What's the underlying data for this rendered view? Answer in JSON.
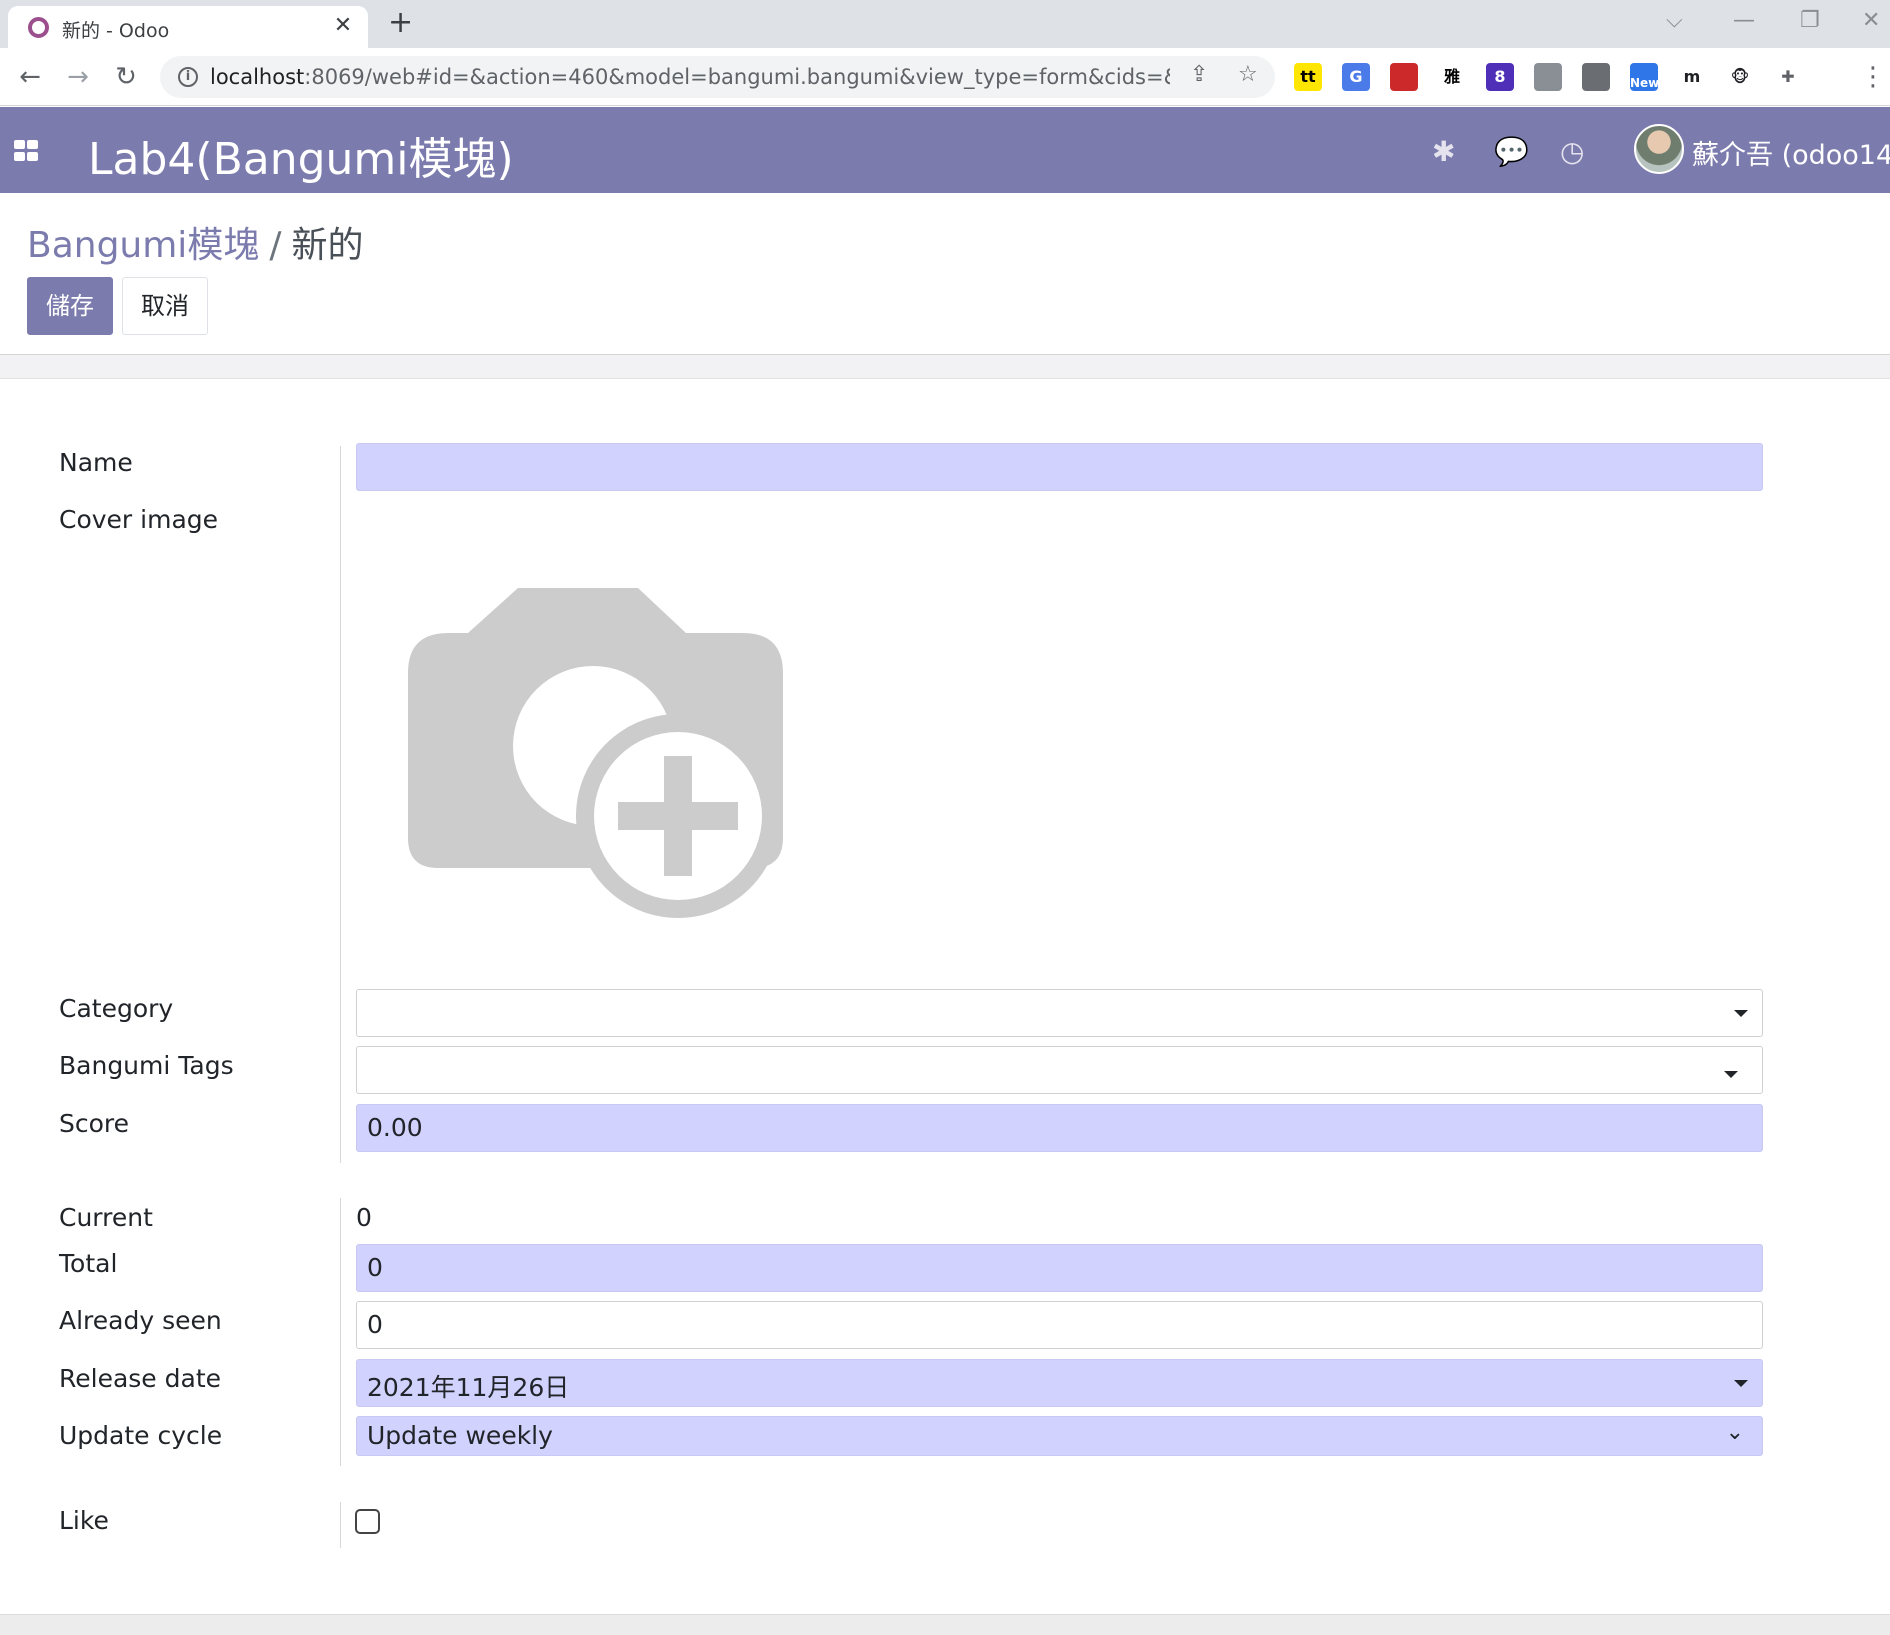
{
  "browser": {
    "tab_title": "新的 - Odoo",
    "url_host": "localhost",
    "url_rest": ":8069/web#id=&action=460&model=bangumi.bangumi&view_type=form&cids=&m...",
    "extensions": [
      {
        "icon": "tt-extension-icon",
        "label": "tt",
        "color": "#000000",
        "bg": "#ffe600"
      },
      {
        "icon": "translate-extension-icon",
        "label": "G",
        "color": "#ffffff",
        "bg": "#4a7be8"
      },
      {
        "icon": "red-extension-icon",
        "label": "",
        "color": "#ffffff",
        "bg": "#cc2a2a"
      },
      {
        "icon": "ya-extension-icon",
        "label": "雅",
        "color": "#000000",
        "bg": "#ffffff"
      },
      {
        "icon": "stack-extension-icon",
        "label": "8",
        "color": "#ffffff",
        "bg": "#4f2fb8"
      },
      {
        "icon": "portrait-extension-icon",
        "label": "",
        "color": "#ffffff",
        "bg": "#8a8f95"
      },
      {
        "icon": "chat-extension-icon",
        "label": "",
        "color": "#ffffff",
        "bg": "#6a6e73"
      },
      {
        "icon": "new-extension-icon",
        "label": "New",
        "color": "#ffffff",
        "bg": "#2f76e8"
      },
      {
        "icon": "m-extension-icon",
        "label": "m",
        "color": "#202124",
        "bg": "#ffffff"
      },
      {
        "icon": "monkey-extension-icon",
        "label": "🐵",
        "color": "#202124",
        "bg": "#ffffff"
      },
      {
        "icon": "puzzle-extension-icon",
        "label": "✚",
        "color": "#5f6368",
        "bg": "#ffffff"
      }
    ]
  },
  "navbar": {
    "brand": "Lab4(Bangumi模塊)",
    "user_name": "蘇介吾 (odoo14)"
  },
  "control_panel": {
    "breadcrumb_parent": "Bangumi模塊",
    "breadcrumb_separator": "/",
    "breadcrumb_current": "新的",
    "save_label": "儲存",
    "discard_label": "取消"
  },
  "form": {
    "name": {
      "label": "Name",
      "value": ""
    },
    "cover_image": {
      "label": "Cover image"
    },
    "category": {
      "label": "Category",
      "value": ""
    },
    "bangumi_tags": {
      "label": "Bangumi Tags",
      "value": ""
    },
    "score": {
      "label": "Score",
      "value": "0.00"
    },
    "current": {
      "label": "Current",
      "value": "0"
    },
    "total": {
      "label": "Total",
      "value": "0"
    },
    "already_seen": {
      "label": "Already seen",
      "value": "0"
    },
    "release_date": {
      "label": "Release date",
      "value": "2021年11月26日"
    },
    "update_cycle": {
      "label": "Update cycle",
      "value": "Update weekly"
    },
    "like": {
      "label": "Like",
      "checked": false
    }
  },
  "colors": {
    "brand": "#7c7bad",
    "required_field": "#d2d2ff"
  }
}
